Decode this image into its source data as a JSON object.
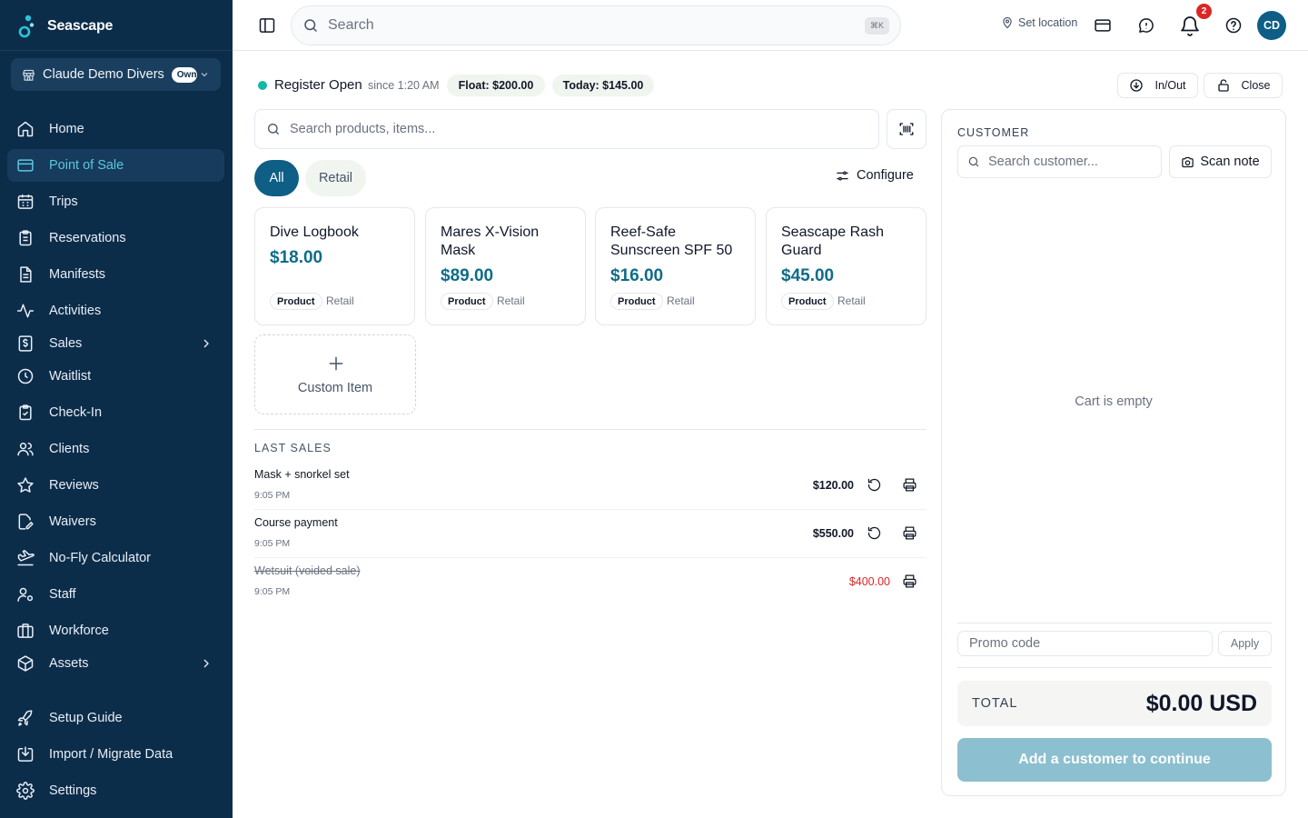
{
  "app": {
    "name": "Seascape"
  },
  "colors": {
    "sidebar_bg": "#0c2d4a",
    "accent": "#0e5e86",
    "price": "#0e6c89",
    "status_open": "#14b8a6",
    "danger": "#dc2626"
  },
  "org": {
    "name": "Claude Demo Divers",
    "badge": "Owner"
  },
  "sidebar": {
    "items": [
      {
        "label": "Home",
        "icon": "home-icon"
      },
      {
        "label": "Point of Sale",
        "icon": "credit-card-icon",
        "active": true
      },
      {
        "label": "Trips",
        "icon": "calendar-icon"
      },
      {
        "label": "Reservations",
        "icon": "clipboard-icon"
      },
      {
        "label": "Manifests",
        "icon": "document-icon"
      },
      {
        "label": "Activities",
        "icon": "activity-icon"
      },
      {
        "label": "Sales",
        "icon": "receipt-dollar-icon",
        "expandable": true
      },
      {
        "label": "Waitlist",
        "icon": "clock-icon"
      },
      {
        "label": "Check-In",
        "icon": "clipboard-check-icon"
      },
      {
        "label": "Clients",
        "icon": "users-icon"
      },
      {
        "label": "Reviews",
        "icon": "star-icon"
      },
      {
        "label": "Waivers",
        "icon": "file-edit-icon"
      },
      {
        "label": "No-Fly Calculator",
        "icon": "plane-landing-icon"
      },
      {
        "label": "Staff",
        "icon": "user-cog-icon"
      },
      {
        "label": "Workforce",
        "icon": "briefcase-icon"
      },
      {
        "label": "Assets",
        "icon": "package-icon",
        "expandable": true
      },
      {
        "label": "Setup Guide",
        "icon": "rocket-icon"
      },
      {
        "label": "Import / Migrate Data",
        "icon": "import-icon"
      },
      {
        "label": "Settings",
        "icon": "gear-icon"
      }
    ]
  },
  "topbar": {
    "search_placeholder": "Search",
    "shortcut": "⌘K",
    "set_location": "Set location",
    "notification_count": "2",
    "avatar_initials": "CD"
  },
  "register": {
    "status": "Register Open",
    "since": "since 1:20 AM",
    "float": "Float: $200.00",
    "today": "Today: $145.00",
    "in_out_label": "In/Out",
    "close_label": "Close"
  },
  "products": {
    "search_placeholder": "Search products, items...",
    "tabs": [
      {
        "label": "All",
        "active": true
      },
      {
        "label": "Retail",
        "active": false
      }
    ],
    "configure_label": "Configure",
    "items": [
      {
        "name": "Dive Logbook",
        "price": "$18.00",
        "type": "Product",
        "category": "Retail"
      },
      {
        "name": "Mares X-Vision Mask",
        "price": "$89.00",
        "type": "Product",
        "category": "Retail"
      },
      {
        "name": "Reef-Safe Sunscreen SPF 50",
        "price": "$16.00",
        "type": "Product",
        "category": "Retail"
      },
      {
        "name": "Seascape Rash Guard",
        "price": "$45.00",
        "type": "Product",
        "category": "Retail"
      }
    ],
    "custom_item_label": "Custom Item"
  },
  "last_sales": {
    "title": "LAST SALES",
    "rows": [
      {
        "name": "Mask + snorkel set",
        "time": "9:05 PM",
        "amount": "$120.00",
        "voided": false
      },
      {
        "name": "Course payment",
        "time": "9:05 PM",
        "amount": "$550.00",
        "voided": false
      },
      {
        "name": "Wetsuit (voided sale)",
        "time": "9:05 PM",
        "amount": "$400.00",
        "voided": true
      }
    ]
  },
  "customer": {
    "title": "CUSTOMER",
    "search_placeholder": "Search customer...",
    "scan_note_label": "Scan note",
    "cart_empty": "Cart is empty",
    "promo_placeholder": "Promo code",
    "apply_label": "Apply",
    "total_label": "TOTAL",
    "total_value": "$0.00 USD",
    "continue_label": "Add a customer to continue"
  }
}
